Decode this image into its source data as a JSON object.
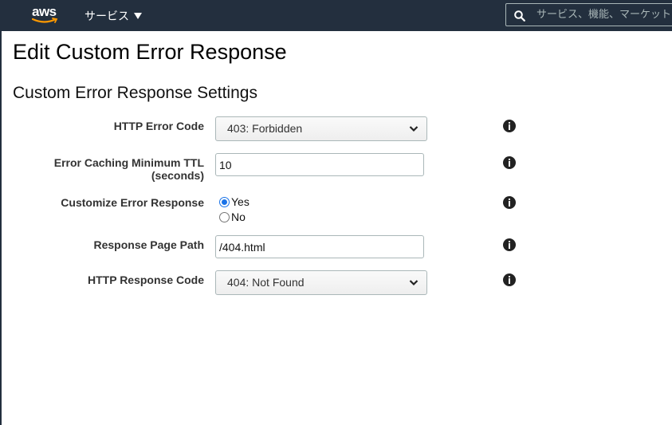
{
  "header": {
    "logo_text": "aws",
    "services_label": "サービス",
    "search_placeholder": "サービス、機能、マーケット"
  },
  "page": {
    "title": "Edit Custom Error Response",
    "section_title": "Custom Error Response Settings"
  },
  "form": {
    "http_error_code": {
      "label": "HTTP Error Code",
      "value": "403: Forbidden"
    },
    "error_caching_ttl": {
      "label_line1": "Error Caching Minimum TTL",
      "label_line2": "(seconds)",
      "value": "10"
    },
    "customize_error_response": {
      "label": "Customize Error Response",
      "options": [
        "Yes",
        "No"
      ],
      "selected": "Yes"
    },
    "response_page_path": {
      "label": "Response Page Path",
      "value": "/404.html"
    },
    "http_response_code": {
      "label": "HTTP Response Code",
      "value": "404: Not Found"
    }
  },
  "icons": {
    "info": "info-icon",
    "search": "search-icon",
    "dropdown": "chevron-down-icon"
  },
  "colors": {
    "header_bg": "#232f3e",
    "aws_smile": "#ff9900",
    "radio_accent": "#1a73e8"
  }
}
